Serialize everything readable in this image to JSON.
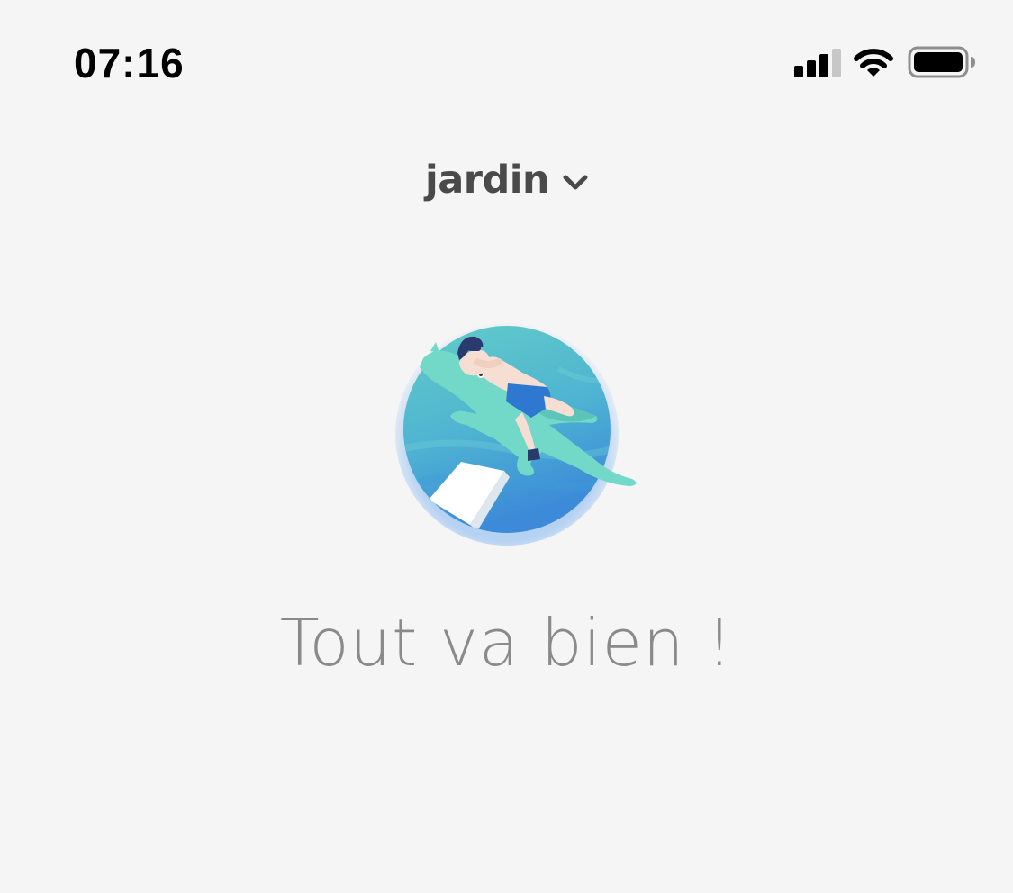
{
  "status_bar": {
    "time": "07:16",
    "signal_icon": "cellular-signal-icon",
    "wifi_icon": "wifi-icon",
    "battery_icon": "battery-icon",
    "signal_bars_active": 3,
    "signal_bars_total": 4,
    "battery_level": 1.0
  },
  "header": {
    "location_name": "jardin",
    "dropdown_icon": "chevron-down-icon"
  },
  "main": {
    "illustration_icon": "person-floating-on-crocodile-pool-float-illustration",
    "status_text": "Tout va bien !"
  },
  "colors": {
    "background": "#f5f5f5",
    "title": "#4a4a4a",
    "message": "#8a8a8a",
    "water_light": "#5ec6cc",
    "water_dark": "#3d8fd6",
    "float_green": "#72d9c8"
  }
}
